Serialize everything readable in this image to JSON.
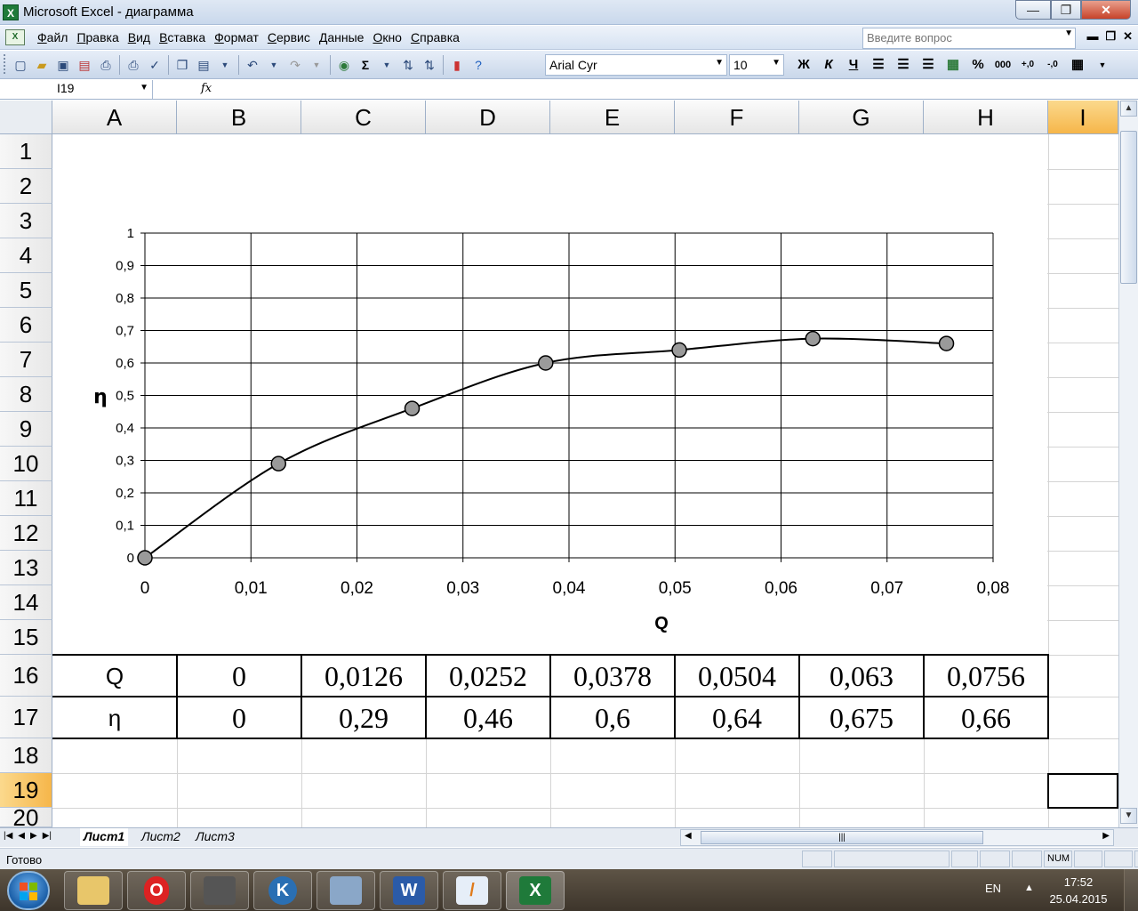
{
  "window": {
    "title": "Microsoft Excel - диаграмма",
    "controls": {
      "minimize": "—",
      "restore": "❐",
      "close": "✕"
    }
  },
  "menu": {
    "items": [
      "Файл",
      "Правка",
      "Вид",
      "Вставка",
      "Формат",
      "Сервис",
      "Данные",
      "Окно",
      "Справка"
    ],
    "ask_placeholder": "Введите вопрос"
  },
  "toolbar": {
    "font_name": "Arial Cyr",
    "font_size": "10",
    "bold": "Ж",
    "italic": "К",
    "underline": "Ч"
  },
  "formula_bar": {
    "name_box": "I19",
    "fx": "fx",
    "content": ""
  },
  "grid": {
    "columns": [
      "A",
      "B",
      "C",
      "D",
      "E",
      "F",
      "G",
      "H",
      "I"
    ],
    "rows": [
      "1",
      "2",
      "3",
      "4",
      "5",
      "6",
      "7",
      "8",
      "9",
      "10",
      "11",
      "12",
      "13",
      "14",
      "15",
      "16",
      "17",
      "18",
      "19",
      "20"
    ],
    "selected_column": "I",
    "selected_row": "19",
    "table": {
      "row16": [
        "Q",
        "0",
        "0,0126",
        "0,0252",
        "0,0378",
        "0,0504",
        "0,063",
        "0,0756"
      ],
      "row17": [
        "η",
        "0",
        "0,29",
        "0,46",
        "0,6",
        "0,64",
        "0,675",
        "0,66"
      ]
    }
  },
  "chart_data": {
    "type": "scatter",
    "smooth": true,
    "xlabel": "Q",
    "ylabel": "η",
    "xlim": [
      0,
      0.08
    ],
    "ylim": [
      0,
      1
    ],
    "x_ticks": [
      "0",
      "0,01",
      "0,02",
      "0,03",
      "0,04",
      "0,05",
      "0,06",
      "0,07",
      "0,08"
    ],
    "y_ticks": [
      "0",
      "0,1",
      "0,2",
      "0,3",
      "0,4",
      "0,5",
      "0,6",
      "0,7",
      "0,8",
      "0,9",
      "1"
    ],
    "grid": true,
    "legend": "none",
    "marker_color": "#9a9a9a",
    "line_color": "#000000",
    "points": [
      {
        "x": 0,
        "y": 0
      },
      {
        "x": 0.0126,
        "y": 0.29
      },
      {
        "x": 0.0252,
        "y": 0.46
      },
      {
        "x": 0.0378,
        "y": 0.6
      },
      {
        "x": 0.0504,
        "y": 0.64
      },
      {
        "x": 0.063,
        "y": 0.675
      },
      {
        "x": 0.0756,
        "y": 0.66
      }
    ]
  },
  "sheets": {
    "tabs": [
      "Лист1",
      "Лист2",
      "Лист3"
    ],
    "active": "Лист1"
  },
  "status": {
    "text": "Готово",
    "num": "NUM"
  },
  "taskbar": {
    "lang": "EN",
    "time": "17:52",
    "date": "25.04.2015"
  }
}
